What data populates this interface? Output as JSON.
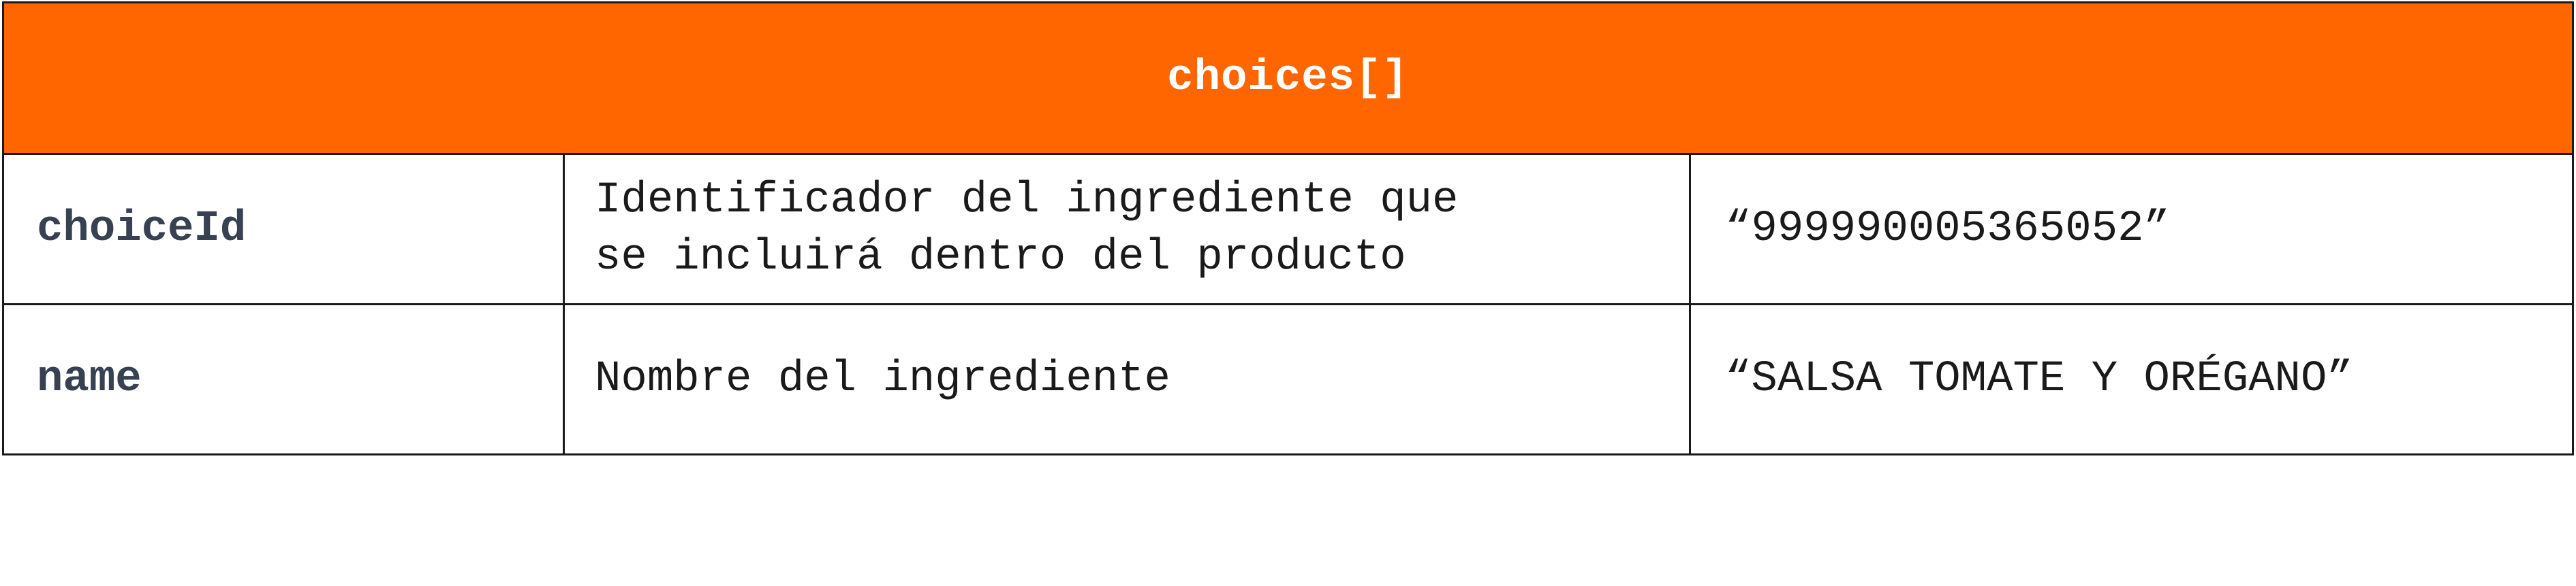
{
  "table": {
    "title": "choices[]",
    "header_color": "#ff6600",
    "rows": [
      {
        "key": "choiceId",
        "description_lines": [
          "Identificador del ingrediente que",
          "se incluirá dentro del producto"
        ],
        "example": "“999990005365052”"
      },
      {
        "key": "name",
        "description_lines": [
          "Nombre del ingrediente"
        ],
        "example": "“SALSA TOMATE Y ORÉGANO”"
      }
    ]
  }
}
